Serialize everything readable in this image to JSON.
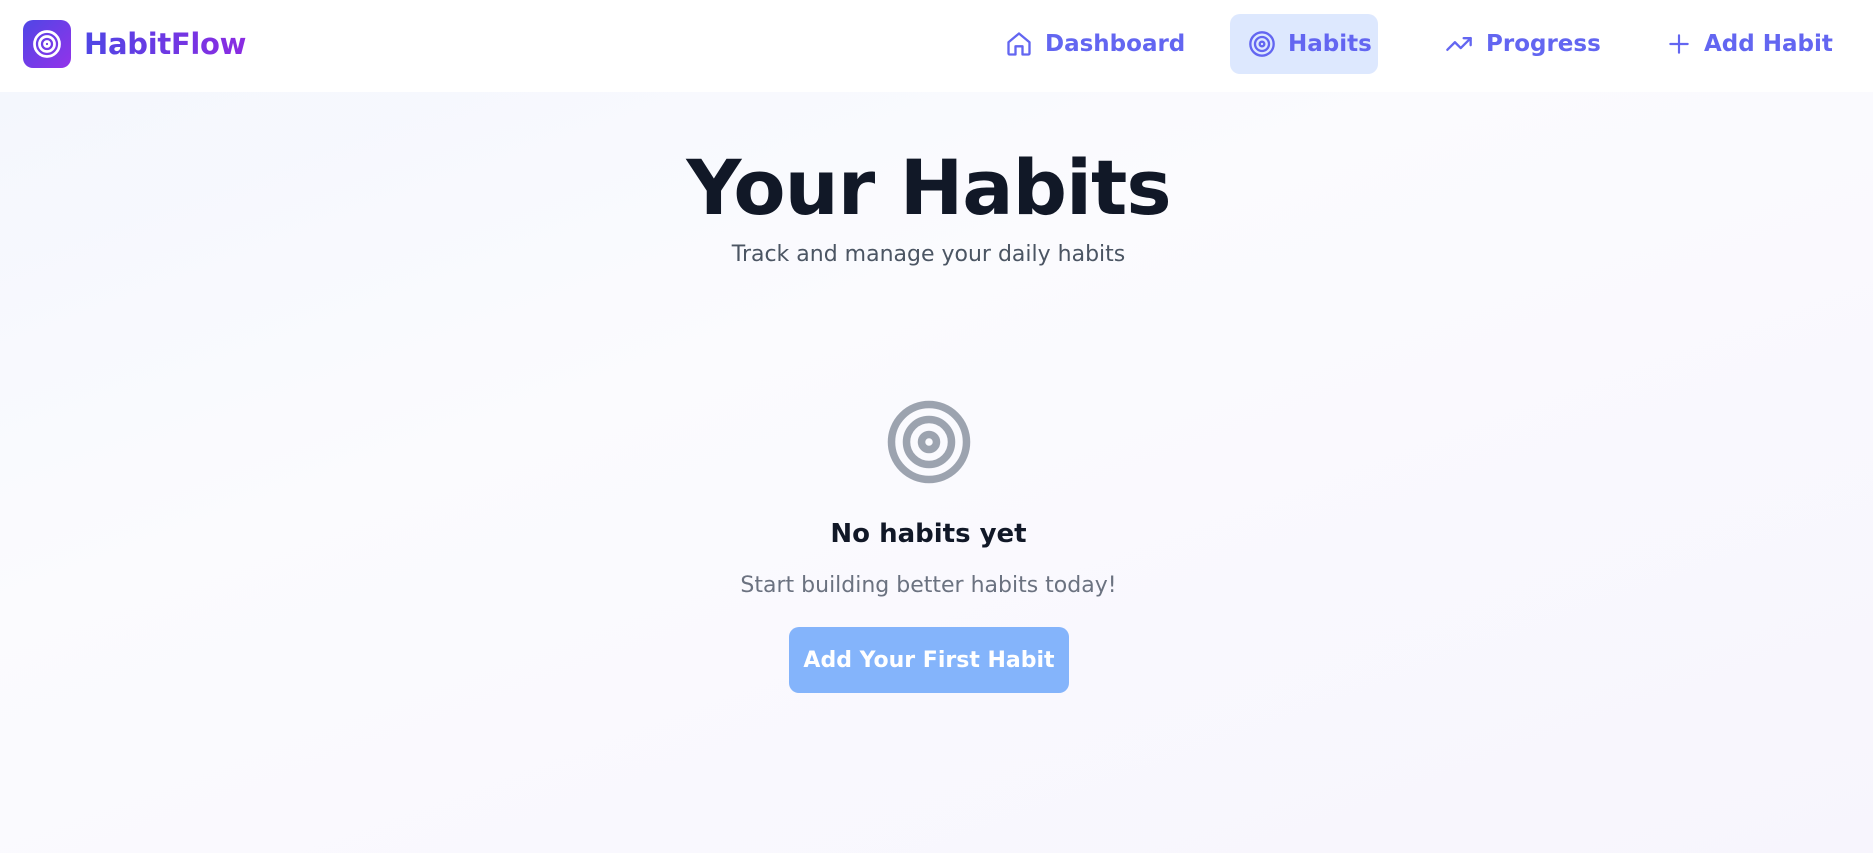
{
  "brand": {
    "name": "HabitFlow",
    "icon": "target-icon"
  },
  "nav": {
    "dashboard": {
      "label": "Dashboard",
      "icon": "home-icon"
    },
    "habits": {
      "label": "Habits",
      "icon": "target-icon",
      "active": true
    },
    "progress": {
      "label": "Progress",
      "icon": "trending-up-icon"
    },
    "add_habit": {
      "label": "Add Habit",
      "icon": "plus-icon"
    }
  },
  "page": {
    "title": "Your Habits",
    "subtitle": "Track and manage your daily habits"
  },
  "empty_state": {
    "icon": "target-icon",
    "title": "No habits yet",
    "text": "Start building better habits today!",
    "button_label": "Add Your First Habit"
  },
  "colors": {
    "brand_gradient_start": "#4f46e5",
    "brand_gradient_end": "#9333ea",
    "nav_text": "#6366f1",
    "nav_active_bg": "#dde8fe",
    "cta_button": "#84b4fb"
  }
}
